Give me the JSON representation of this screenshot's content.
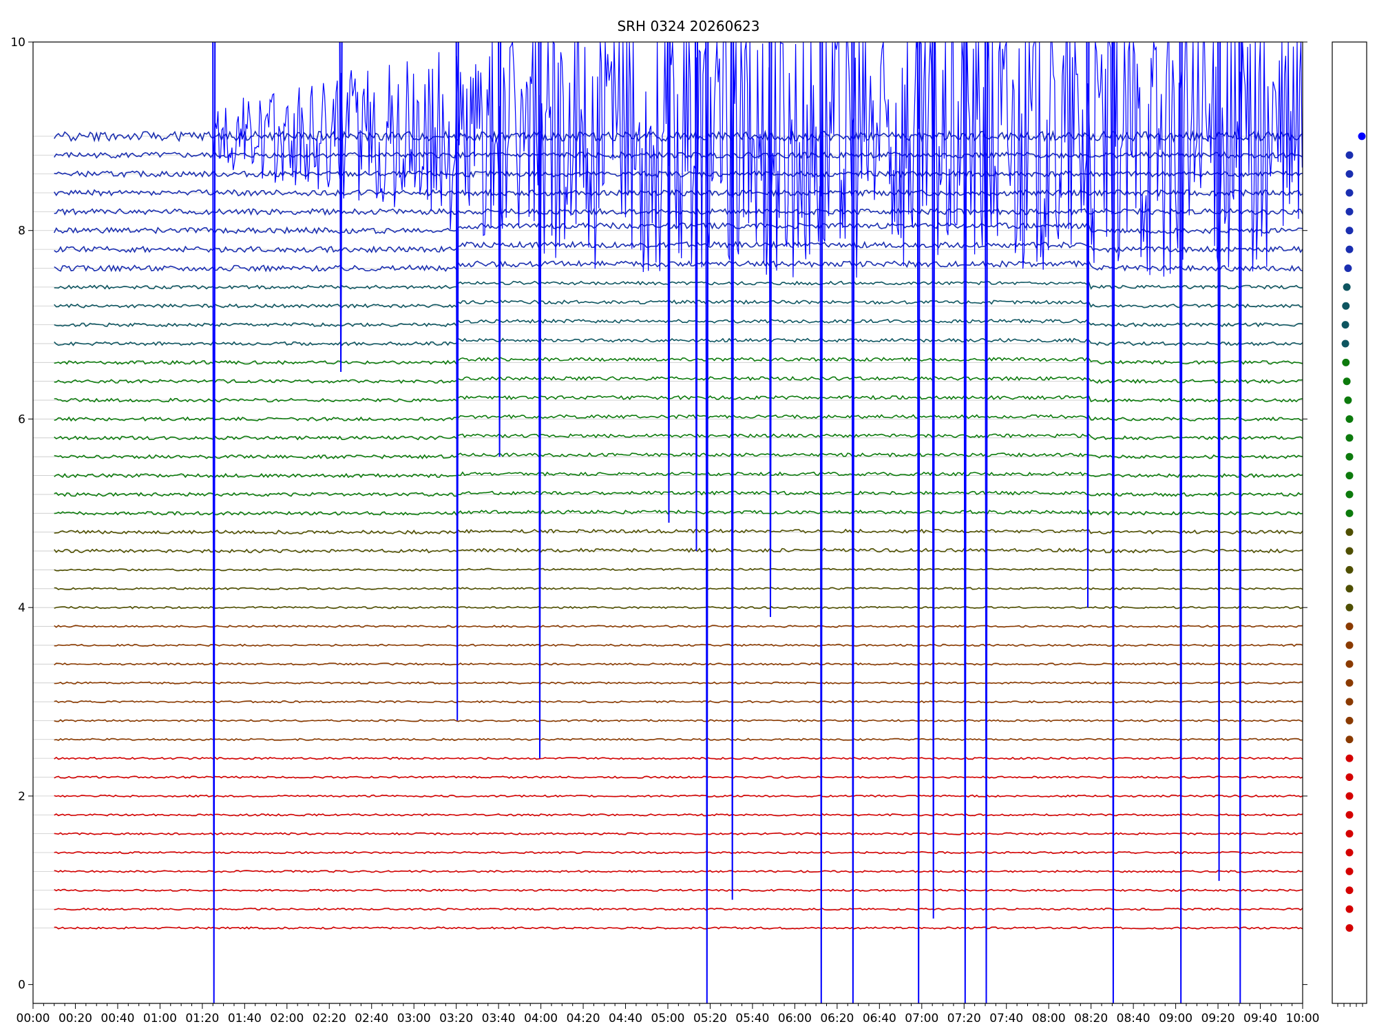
{
  "chart_data": {
    "type": "line",
    "title": "SRH 0324 20260623",
    "xlabel": "",
    "ylabel": "",
    "xlim": [
      "00:00",
      "10:00"
    ],
    "ylim": [
      -0.2,
      10
    ],
    "x_ticks": [
      "00:00",
      "00:20",
      "00:40",
      "01:00",
      "01:20",
      "01:40",
      "02:00",
      "02:20",
      "02:40",
      "03:00",
      "03:20",
      "03:40",
      "04:00",
      "04:20",
      "04:40",
      "05:00",
      "05:20",
      "05:40",
      "06:00",
      "06:20",
      "06:40",
      "07:00",
      "07:20",
      "07:40",
      "08:00",
      "08:20",
      "08:40",
      "09:00",
      "09:20",
      "09:40",
      "10:00"
    ],
    "y_ticks": [
      0,
      2,
      4,
      6,
      8,
      10
    ],
    "grid": "horizontal lines at every channel baseline",
    "series_start": "00:10",
    "series_end": "10:00",
    "channel_count": 43,
    "channel_spacing": 0.2,
    "top_channel_baseline": 9.0,
    "colors": {
      "low_channels": "#d40000",
      "mid_low_channels": "#8a3a00",
      "mid_channels": "#4f4f00",
      "green_channels": "#0c7a0c",
      "teal_channels": "#0e5560",
      "high_channels": "#1a2eb0",
      "strong_signal": "#0000ff",
      "grid": "#c8c8c8"
    },
    "strong_dips_top_channel": [
      {
        "time": "01:25",
        "value": -0.2
      },
      {
        "time": "02:25",
        "value": 6.5
      },
      {
        "time": "03:20",
        "value": 2.8
      },
      {
        "time": "03:40",
        "value": 5.6
      },
      {
        "time": "03:59",
        "value": 2.4
      },
      {
        "time": "05:00",
        "value": 4.9
      },
      {
        "time": "05:13",
        "value": 4.6
      },
      {
        "time": "05:18",
        "value": -0.2
      },
      {
        "time": "05:30",
        "value": 0.9
      },
      {
        "time": "05:48",
        "value": 3.9
      },
      {
        "time": "06:12",
        "value": -0.2
      },
      {
        "time": "06:27",
        "value": -0.2
      },
      {
        "time": "06:58",
        "value": -0.2
      },
      {
        "time": "07:05",
        "value": 0.7
      },
      {
        "time": "07:20",
        "value": -0.2
      },
      {
        "time": "07:30",
        "value": -0.2
      },
      {
        "time": "08:18",
        "value": 4.0
      },
      {
        "time": "08:30",
        "value": -0.2
      },
      {
        "time": "09:02",
        "value": -0.2
      },
      {
        "time": "09:20",
        "value": 1.1
      },
      {
        "time": "09:30",
        "value": -0.2
      }
    ],
    "side_panel": {
      "type": "scatter",
      "description_values": "one marker per channel at its baseline level",
      "top_marker": {
        "x_offset": 1,
        "y": 9.0
      }
    }
  }
}
